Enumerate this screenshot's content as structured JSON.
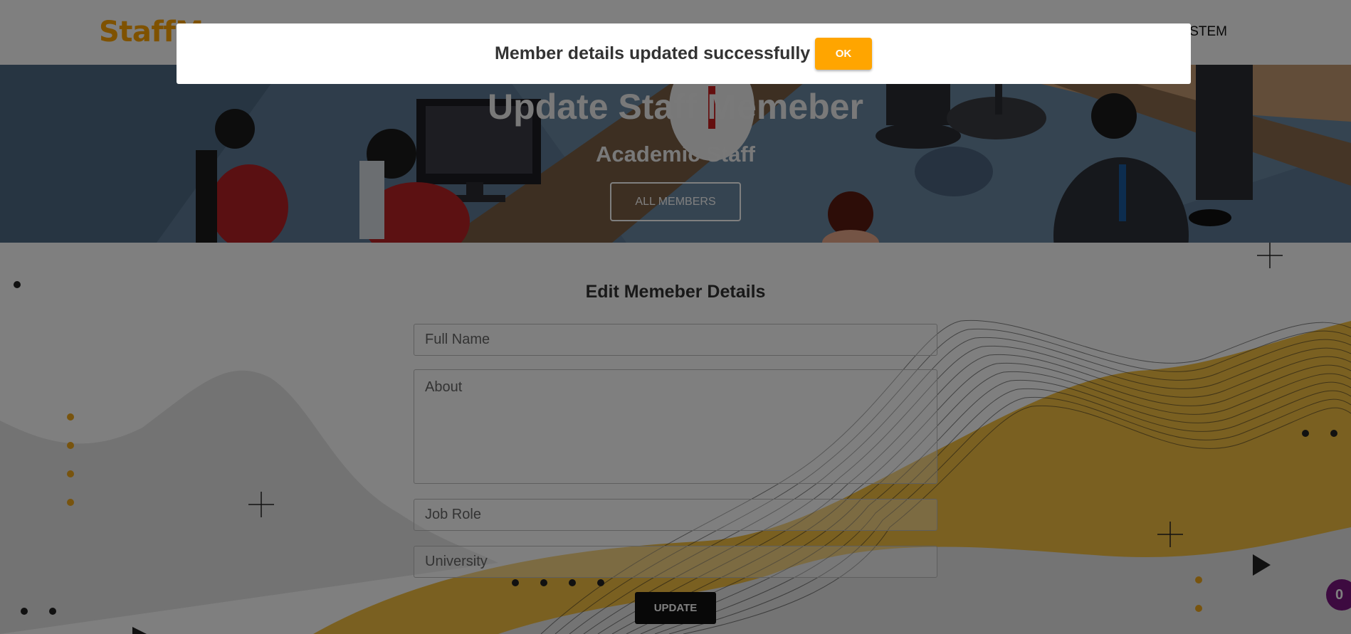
{
  "navbar": {
    "brand": "StaffM",
    "nav_item": "T SYSTEM"
  },
  "hero": {
    "title": "Update Staff Memeber",
    "subtitle": "Academic Staff",
    "button_label": "ALL MEMBERS"
  },
  "form": {
    "title": "Edit Memeber Details",
    "full_name_placeholder": "Full Name",
    "about_placeholder": "About",
    "job_role_placeholder": "Job Role",
    "university_placeholder": "University",
    "update_label": "UPDATE"
  },
  "badge": {
    "count": "0"
  },
  "modal": {
    "message": "Member details updated successfully !",
    "ok_label": "OK"
  },
  "colors": {
    "accent": "#ffa500",
    "dark_button": "#111111",
    "badge": "#7a1480",
    "overlay": "rgba(0,0,0,0.5)"
  }
}
